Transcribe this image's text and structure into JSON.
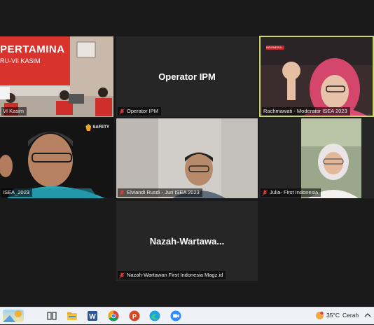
{
  "tiles": [
    {
      "id": "t1",
      "label": "VI Kasim",
      "banner_text": "PERTAMINA",
      "banner_sub": "RU-VII KASIM"
    },
    {
      "id": "t2",
      "label": "Operator IPM",
      "center_name": "Operator IPM"
    },
    {
      "id": "t3",
      "label": "Rachmawati - Moderator ISEA 2023",
      "badge": "INDONESIA"
    },
    {
      "id": "t4",
      "label": "ISEA_2023",
      "overlay_logo": "SAFETY"
    },
    {
      "id": "t5",
      "label": "Elviandi Rusdi - Juri ISEA 2023"
    },
    {
      "id": "t6",
      "label": "Julia- First Indonesia"
    },
    {
      "id": "t7",
      "label": "Nazah-Wartawan First Indonesia Magz.id",
      "center_name": "Nazah-Wartawa..."
    }
  ],
  "taskbar": {
    "temperature": "35°C",
    "condition": "Cerah",
    "icons": [
      "widgets-icon",
      "task-view-icon",
      "file-explorer-icon",
      "word-icon",
      "chrome-icon",
      "powerpoint-icon",
      "edge-icon",
      "zoom-icon"
    ]
  },
  "colors": {
    "mic_muted": "#e03a3a",
    "active_speaker_border": "#c8d66a",
    "pertamina_red": "#d22a2a"
  }
}
